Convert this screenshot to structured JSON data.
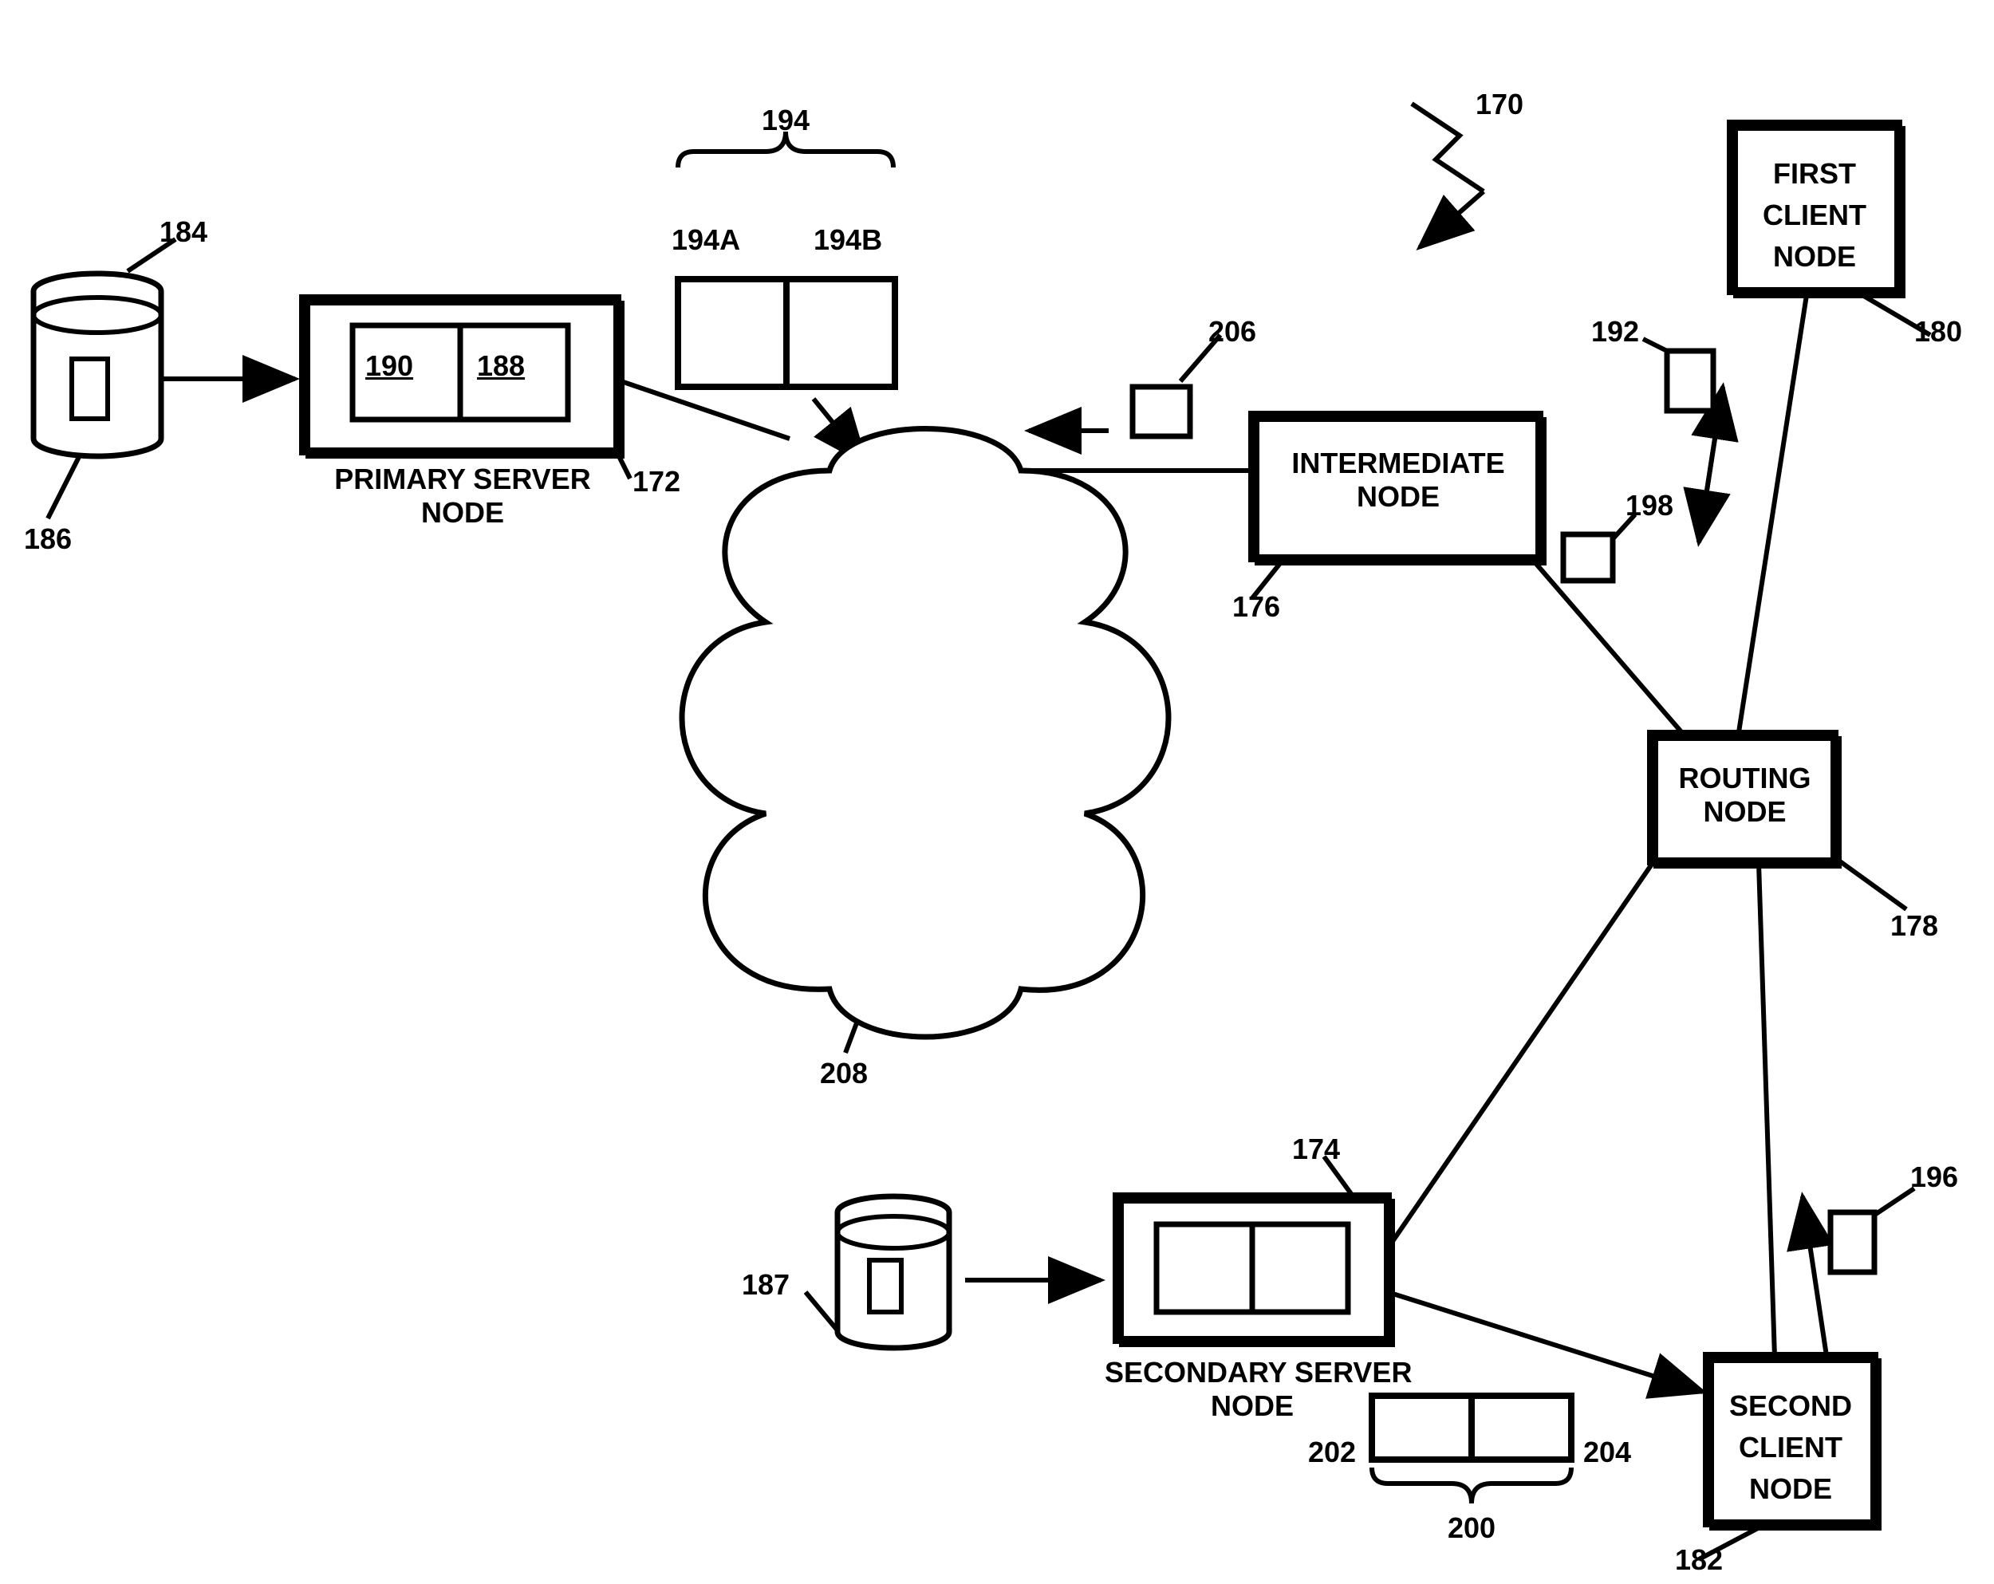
{
  "nodes": {
    "primary_server": {
      "label": "PRIMARY SERVER\nNODE",
      "ref": "172",
      "inner_left": "190",
      "inner_right": "188"
    },
    "secondary_server": {
      "label": "SECONDARY SERVER\nNODE",
      "ref": "174"
    },
    "intermediate": {
      "label": "INTERMEDIATE\nNODE",
      "ref": "176"
    },
    "routing": {
      "label": "ROUTING\nNODE",
      "ref": "178"
    },
    "first_client": {
      "label": "FIRST\nCLIENT\nNODE",
      "ref": "180"
    },
    "second_client": {
      "label": "SECOND\nCLIENT\nNODE",
      "ref": "182"
    }
  },
  "storage": {
    "left": {
      "ref_top": "184",
      "ref_inner": "186"
    },
    "right": {
      "ref": "187"
    }
  },
  "packets": {
    "pair_top": {
      "ref_group": "194",
      "ref_left": "194A",
      "ref_right": "194B"
    },
    "pair_bottom": {
      "ref_group": "200",
      "ref_left": "202",
      "ref_right": "204"
    },
    "small_192": "192",
    "small_196": "196",
    "small_198": "198",
    "small_206": "206"
  },
  "cloud": {
    "ref": "208"
  },
  "figure_mark": {
    "ref": "170"
  }
}
